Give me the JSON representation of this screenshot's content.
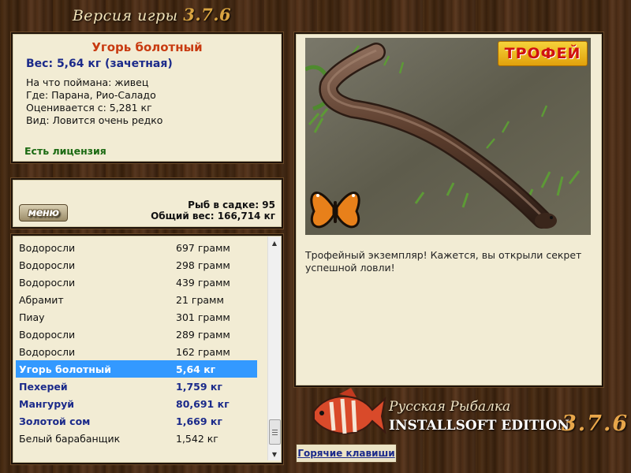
{
  "header": {
    "title_prefix": "Версия игры",
    "version": "3.7.6"
  },
  "fish_card": {
    "name": "Угорь болотный",
    "weight": "Вес: 5,64 кг (зачетная)",
    "details": [
      "На что поймана: живец",
      "Где: Парана, Рио-Саладо",
      "Оценивается с: 5,281 кг",
      "Вид: Ловится очень редко"
    ],
    "license": "Есть лицензия"
  },
  "keep_net": {
    "menu_label": "меню",
    "fish_count": "Рыб в садке: 95",
    "total_weight": "Общий вес: 166,714 кг"
  },
  "catch_list": [
    {
      "name": "Водоросли",
      "weight": "697 грамм",
      "style": "normal"
    },
    {
      "name": "Водоросли",
      "weight": "298 грамм",
      "style": "normal"
    },
    {
      "name": "Водоросли",
      "weight": "439 грамм",
      "style": "normal"
    },
    {
      "name": "Абрамит",
      "weight": "21 грамм",
      "style": "normal"
    },
    {
      "name": "Пиау",
      "weight": "301 грамм",
      "style": "normal"
    },
    {
      "name": "Водоросли",
      "weight": "289 грамм",
      "style": "normal"
    },
    {
      "name": "Водоросли",
      "weight": "162 грамм",
      "style": "normal"
    },
    {
      "name": "Угорь болотный",
      "weight": "5,64 кг",
      "style": "selected"
    },
    {
      "name": "Пехерей",
      "weight": "1,759 кг",
      "style": "bold"
    },
    {
      "name": "Мангуруй",
      "weight": "80,691 кг",
      "style": "bold"
    },
    {
      "name": "Золотой сом",
      "weight": "1,669 кг",
      "style": "bold"
    },
    {
      "name": "Белый барабанщик",
      "weight": "1,542 кг",
      "style": "normal"
    }
  ],
  "trophy": {
    "badge": "ТРОФЕЙ",
    "description": "Трофейный экземпляр! Кажется, вы открыли секрет успешной ловли!"
  },
  "logo": {
    "line1": "Русская Рыбалка",
    "line2": "INSTALLSOFT EDITION",
    "version": "3.7.6"
  },
  "hotkeys_label": "Горячие клавиши"
}
